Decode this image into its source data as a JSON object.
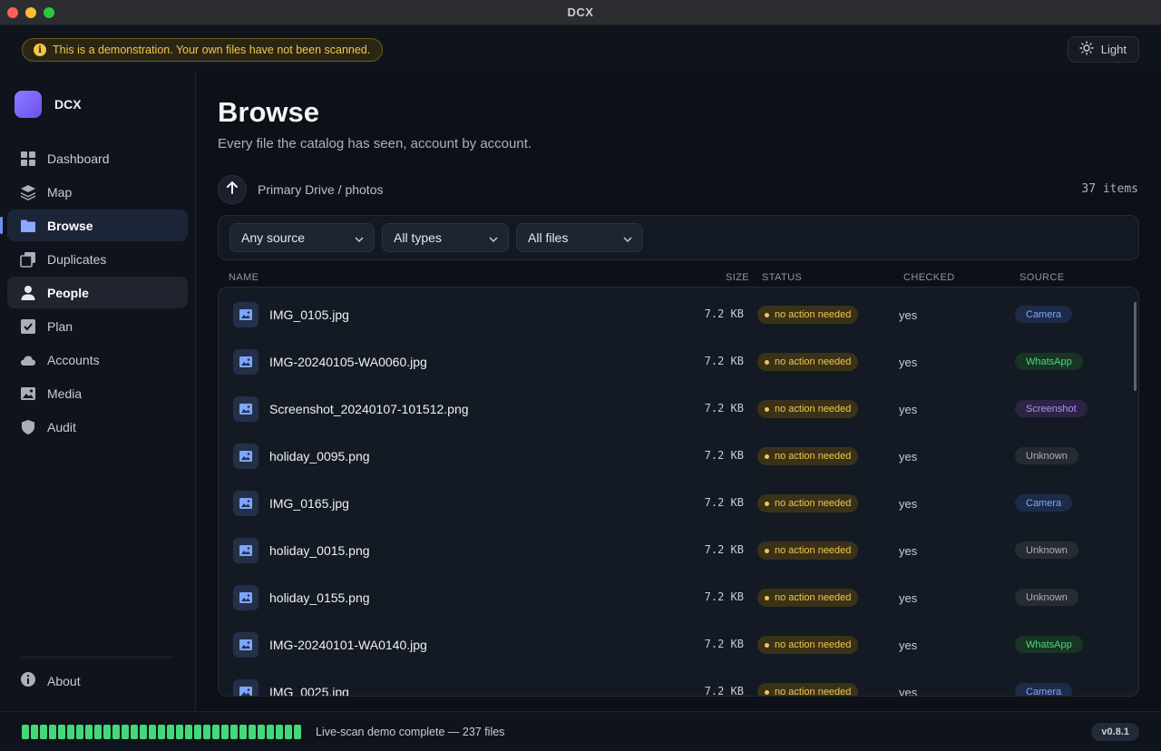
{
  "window": {
    "title": "DCX"
  },
  "banner": {
    "text": "This is a demonstration. Your own files have not been scanned."
  },
  "theme_toggle": {
    "label": "Light"
  },
  "sidebar": {
    "brand": "DCX",
    "items": [
      {
        "label": "Dashboard",
        "icon": "dashboard-icon"
      },
      {
        "label": "Map",
        "icon": "layers-icon"
      },
      {
        "label": "Browse",
        "icon": "folder-icon",
        "active": true
      },
      {
        "label": "Duplicates",
        "icon": "duplicate-icon"
      },
      {
        "label": "People",
        "icon": "person-icon"
      },
      {
        "label": "Plan",
        "icon": "checkbox-icon"
      },
      {
        "label": "Accounts",
        "icon": "cloud-icon"
      },
      {
        "label": "Media",
        "icon": "image-icon"
      },
      {
        "label": "Audit",
        "icon": "shield-icon"
      }
    ],
    "about": "About"
  },
  "main": {
    "title": "Browse",
    "subtitle": "Every file the catalog has seen, account by account.",
    "breadcrumb": "Primary Drive / photos",
    "item_count": "37 items",
    "filters": {
      "source": "Any source",
      "type": "All types",
      "files": "All files"
    },
    "columns": {
      "name": "NAME",
      "size": "SIZE",
      "status": "STATUS",
      "checked": "CHECKED",
      "source": "SOURCE"
    },
    "rows": [
      {
        "name": "IMG_0105.jpg",
        "size": "7.2 KB",
        "status": "no action needed",
        "checked": "yes",
        "source": "Camera"
      },
      {
        "name": "IMG-20240105-WA0060.jpg",
        "size": "7.2 KB",
        "status": "no action needed",
        "checked": "yes",
        "source": "WhatsApp"
      },
      {
        "name": "Screenshot_20240107-101512.png",
        "size": "7.2 KB",
        "status": "no action needed",
        "checked": "yes",
        "source": "Screenshot"
      },
      {
        "name": "holiday_0095.png",
        "size": "7.2 KB",
        "status": "no action needed",
        "checked": "yes",
        "source": "Unknown"
      },
      {
        "name": "IMG_0165.jpg",
        "size": "7.2 KB",
        "status": "no action needed",
        "checked": "yes",
        "source": "Camera"
      },
      {
        "name": "holiday_0015.png",
        "size": "7.2 KB",
        "status": "no action needed",
        "checked": "yes",
        "source": "Unknown"
      },
      {
        "name": "holiday_0155.png",
        "size": "7.2 KB",
        "status": "no action needed",
        "checked": "yes",
        "source": "Unknown"
      },
      {
        "name": "IMG-20240101-WA0140.jpg",
        "size": "7.2 KB",
        "status": "no action needed",
        "checked": "yes",
        "source": "WhatsApp"
      },
      {
        "name": "IMG_0025.jpg",
        "size": "7.2 KB",
        "status": "no action needed",
        "checked": "yes",
        "source": "Camera"
      }
    ]
  },
  "footer": {
    "progress": 1.0,
    "scan_text": "Live-scan demo complete — 237 files",
    "version": "v0.8.1"
  },
  "colors": {
    "accent": "#6f8ef7",
    "warning": "#f3c54a",
    "success": "#45d878",
    "background": "#0d1117"
  }
}
